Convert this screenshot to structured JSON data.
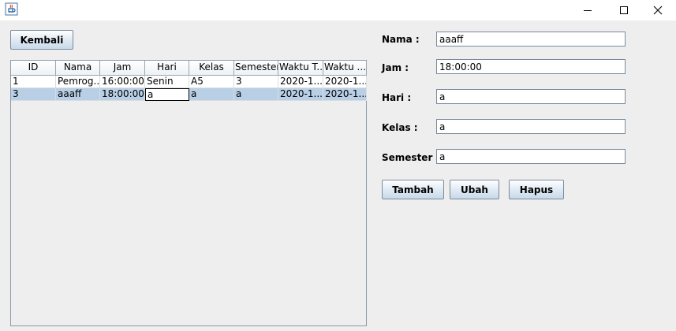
{
  "window": {
    "controls": [
      "minimize-icon",
      "maximize-icon",
      "close-icon"
    ]
  },
  "back_button": {
    "label": "Kembali"
  },
  "table": {
    "columns": [
      "ID",
      "Nama",
      "Jam",
      "Hari",
      "Kelas",
      "Semester",
      "Waktu T...",
      "Waktu ..."
    ],
    "rows": [
      [
        "1",
        "Pemrog...",
        "16:00:00",
        "Senin",
        "A5",
        "3",
        "2020-1...",
        "2020-1..."
      ],
      [
        "3",
        "aaaff",
        "18:00:00",
        "a",
        "a",
        "a",
        "2020-1...",
        "2020-1..."
      ]
    ],
    "selected_row": 1,
    "editing_cell": "Hari"
  },
  "form": {
    "nama": {
      "label": "Nama :",
      "value": "aaaff"
    },
    "jam": {
      "label": "Jam :",
      "value": "18:00:00"
    },
    "hari": {
      "label": "Hari :",
      "value": "a"
    },
    "kelas": {
      "label": "Kelas :",
      "value": "a"
    },
    "semester": {
      "label": "Semester :",
      "value": "a"
    }
  },
  "actions": {
    "add_label": "Tambah",
    "edit_label": "Ubah",
    "delete_label": "Hapus"
  }
}
